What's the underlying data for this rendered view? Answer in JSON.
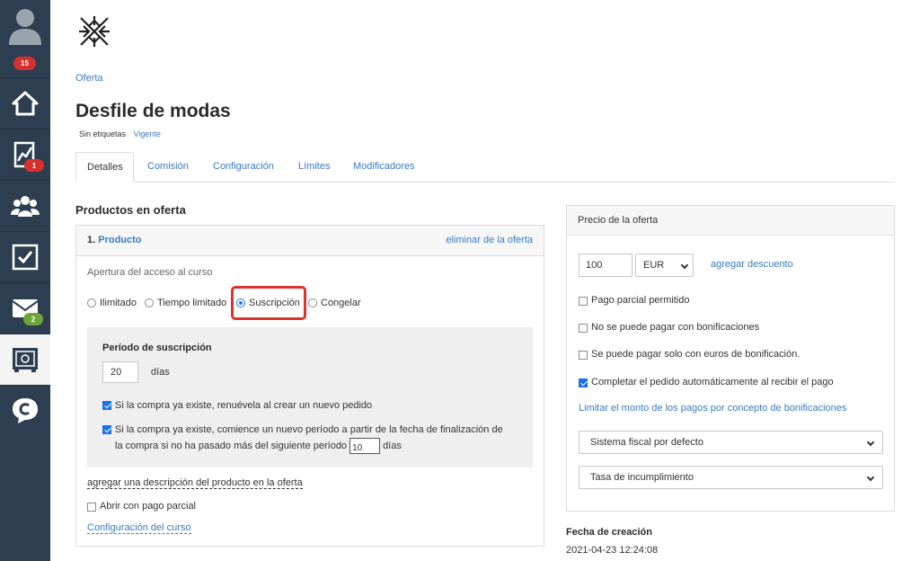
{
  "sidebar": {
    "avatar_badge": "15",
    "items": [
      {
        "name": "home",
        "icon": "home-icon",
        "badge": ""
      },
      {
        "name": "stats",
        "icon": "chart-icon",
        "badge": "1"
      },
      {
        "name": "users",
        "icon": "users-icon",
        "badge": ""
      },
      {
        "name": "tasks",
        "icon": "checkbox-icon",
        "badge": ""
      },
      {
        "name": "mail",
        "icon": "mail-icon",
        "badge": "2"
      },
      {
        "name": "safe",
        "icon": "safe-icon",
        "badge": ""
      },
      {
        "name": "chat",
        "icon": "chat-icon",
        "badge": ""
      }
    ]
  },
  "breadcrumb": "Oferta",
  "title": "Desfile de modas",
  "tags": {
    "none": "Sin etiquetas",
    "status": "Vigente"
  },
  "tabs": [
    "Detalles",
    "Comisión",
    "Configuración",
    "Límites",
    "Modificadores"
  ],
  "products": {
    "section_title": "Productos en oferta",
    "number": "1.",
    "product_label": "Producto",
    "delete_link": "eliminar de la oferta",
    "access_label": "Apertura del acceso al curso",
    "access_options": [
      "Ilimitado",
      "Tiempo limitado",
      "Suscripción",
      "Congelar"
    ],
    "access_selected": "Suscripción",
    "subscription": {
      "title": "Período de suscripción",
      "days_value": "20",
      "days_label": "días",
      "renew_text": "Si la compra ya existe, renuévela al crear un nuevo pedido",
      "new_period_line1": "Si la compra ya existe, comience un nuevo período a partir de la fecha de finalización de",
      "new_period_line2": "la compra si no ha pasado más del siguiente período",
      "new_period_days": "10",
      "new_period_unit": "días"
    },
    "add_description": "agregar una descripción del producto en la oferta",
    "partial_payment": "Abrir con pago parcial",
    "course_config": "Configuración del curso"
  },
  "price": {
    "title": "Precio de la oferta",
    "amount": "100",
    "currency": "EUR",
    "discount_link": "agregar descuento",
    "checks": [
      {
        "label": "Pago parcial permitido",
        "checked": false
      },
      {
        "label": "No se puede pagar con bonificaciones",
        "checked": false
      },
      {
        "label": "Se puede pagar solo con euros de bonificación.",
        "checked": false
      },
      {
        "label": "Completar el pedido automáticamente al recibir el pago",
        "checked": true
      }
    ],
    "limit_link": "Limitar el monto de los pagos por concepto de bonificaciones",
    "tax_system": "Sistema fiscal por defecto",
    "default_rate": "Tasa de incumplimiento"
  },
  "created": {
    "label": "Fecha de creación",
    "value": "2021-04-23 12:24:08"
  },
  "colors": {
    "sidebar": "#2d3e50",
    "link": "#3a7bbf",
    "accent": "#1a73e8",
    "highlight": "#e03131",
    "badge_red": "#d9302f",
    "badge_green": "#6ea43c"
  }
}
